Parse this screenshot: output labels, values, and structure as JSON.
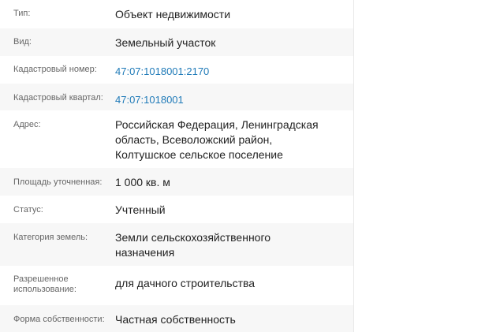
{
  "properties": [
    {
      "label": [
        "Тип:"
      ],
      "value": [
        "Объект недвижимости"
      ],
      "link": false
    },
    {
      "label": [
        "Вид:"
      ],
      "value": [
        "Земельный участок"
      ],
      "link": false
    },
    {
      "label": [
        "Кадастровый номер:"
      ],
      "value": [
        "47:07:1018001:2170"
      ],
      "link": true
    },
    {
      "label": [
        "Кадастровый квартал:"
      ],
      "value": [
        "47:07:1018001"
      ],
      "link": true
    },
    {
      "label": [
        "Адрес:"
      ],
      "value": [
        "Российская Федерация, Ленинградская",
        "область, Всеволожский район,",
        "Колтушское сельское поселение"
      ],
      "link": false
    },
    {
      "label": [
        "Площадь уточненная:"
      ],
      "value": [
        "1 000 кв. м"
      ],
      "link": false
    },
    {
      "label": [
        "Статус:"
      ],
      "value": [
        "Учтенный"
      ],
      "link": false
    },
    {
      "label": [
        "Категория земель:"
      ],
      "value": [
        "Земли сельскохозяйственного",
        "назначения"
      ],
      "link": false
    },
    {
      "label": [
        "Разрешенное",
        "использование:"
      ],
      "value": [
        "для дачного строительства"
      ],
      "link": false
    },
    {
      "label": [
        "Форма собственности:"
      ],
      "value": [
        "Частная собственность"
      ],
      "link": false
    }
  ]
}
